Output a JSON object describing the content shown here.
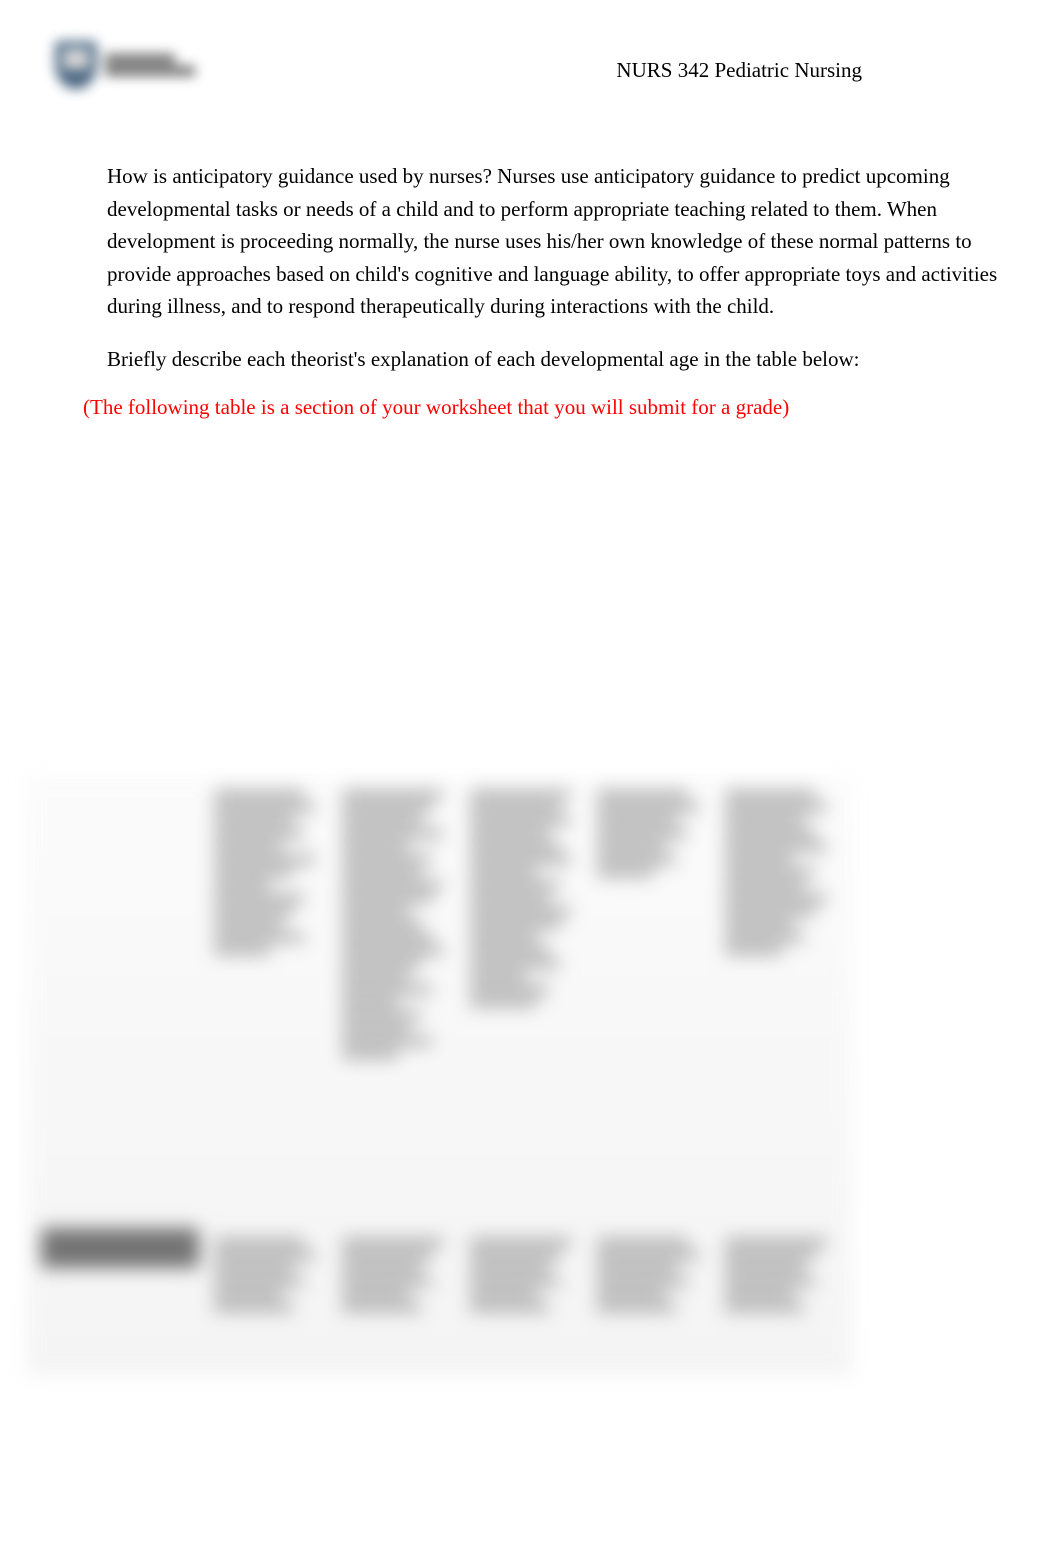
{
  "header": {
    "course_title": "NURS 342 Pediatric Nursing",
    "logo_name": "university-logo"
  },
  "bullets": [
    {
      "marker": "",
      "question": "How is anticipatory guidance used by nurses?   ",
      "answer": "Nurses use anticipatory guidance to predict upcoming developmental tasks or needs of a child and to perform appropriate teaching related to them. When development is proceeding normally, the nurse uses his/her own knowledge of these normal patterns to provide approaches based on child's cognitive and language ability, to offer appropriate toys and activities during illness, and to respond therapeutically during interactions with the child."
    },
    {
      "marker": "",
      "question": "Briefly describe each theorist's explanation of each developmental age in the table below:",
      "answer": ""
    }
  ],
  "grade_note": "(The following table is a section of your worksheet that you will submit for a grade)",
  "blurred_table": {
    "row_header_label": "Erikson's Stages of development"
  }
}
